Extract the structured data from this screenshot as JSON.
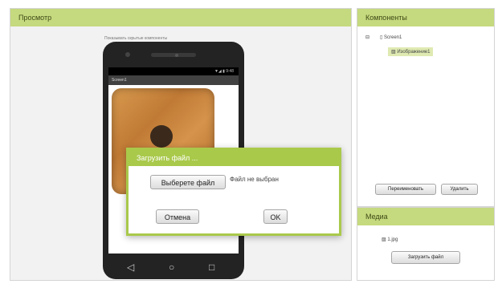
{
  "viewer": {
    "title": "Просмотр",
    "caption": "Показывать скрытые компоненты",
    "phone": {
      "status": "▼◢ ▮ 9:48",
      "screen_title": "Screen1"
    },
    "dialog": {
      "title": "Загрузить файл ...",
      "choose_button": "Выберете файл",
      "no_file_text": "Файл не выбран",
      "cancel_button": "Отмена",
      "ok_button": "OK"
    }
  },
  "components": {
    "title": "Компоненты",
    "tree": [
      {
        "label": "Screen1",
        "icon": "screen-icon"
      },
      {
        "label": "Изображение1",
        "icon": "image-icon"
      }
    ],
    "rename_button": "Переименовать",
    "delete_button": "Удалить"
  },
  "media": {
    "title": "Медиа",
    "files": [
      {
        "label": "1.jpg",
        "icon": "image-file-icon"
      }
    ],
    "upload_button": "Загрузить файл"
  },
  "colors": {
    "header": "#c5d97e",
    "dialog_accent": "#a9c94b",
    "selected": "#dfeab2"
  }
}
